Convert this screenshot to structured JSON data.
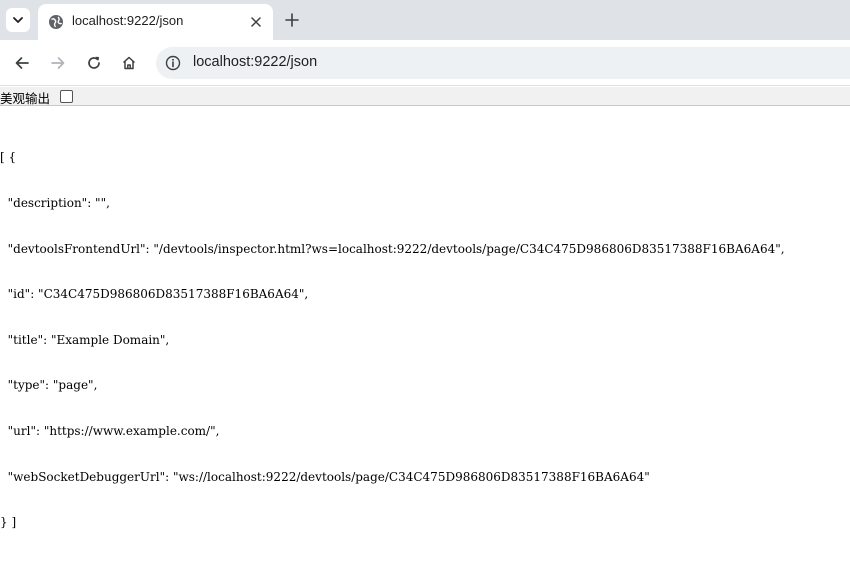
{
  "tab": {
    "title": "localhost:9222/json"
  },
  "address_bar": {
    "url": "localhost:9222/json"
  },
  "pretty_print": {
    "label": "美观输出",
    "checked": false
  },
  "json_lines": [
    "[ {",
    "  \"description\": \"\",",
    "  \"devtoolsFrontendUrl\": \"/devtools/inspector.html?ws=localhost:9222/devtools/page/C34C475D986806D83517388F16BA6A64\",",
    "  \"id\": \"C34C475D986806D83517388F16BA6A64\",",
    "  \"title\": \"Example Domain\",",
    "  \"type\": \"page\",",
    "  \"url\": \"https://www.example.com/\",",
    "  \"webSocketDebuggerUrl\": \"ws://localhost:9222/devtools/page/C34C475D986806D83517388F16BA6A64\"",
    "} ]"
  ],
  "icons": {
    "tab_search": "chevron-down-icon",
    "favicon": "globe-icon",
    "tab_close": "close-icon",
    "new_tab": "plus-icon",
    "back": "back-arrow-icon",
    "forward": "forward-arrow-icon",
    "reload": "reload-icon",
    "home": "home-icon",
    "site_info": "info-icon"
  }
}
